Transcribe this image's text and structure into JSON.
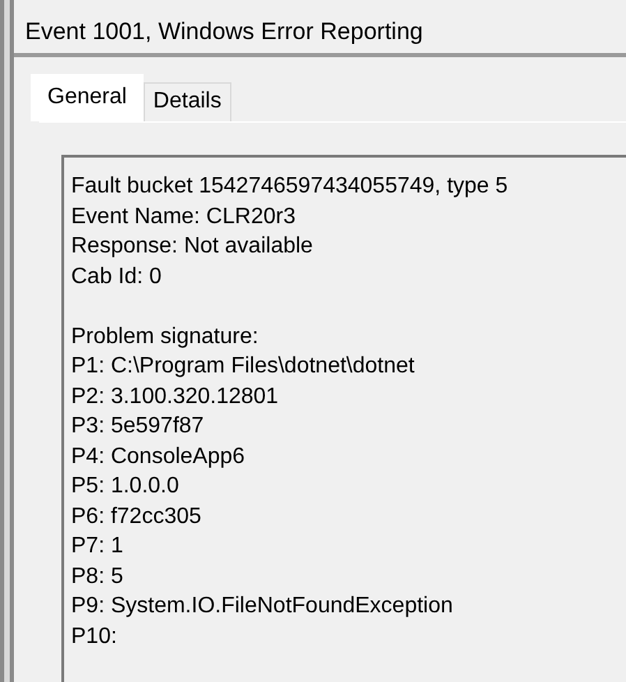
{
  "window": {
    "title": "Event 1001, Windows Error Reporting"
  },
  "tabs": [
    {
      "label": "General",
      "selected": true
    },
    {
      "label": "Details",
      "selected": false
    }
  ],
  "description": {
    "paragraphs": [
      [
        "Fault bucket 1542746597434055749, type 5",
        "Event Name: CLR20r3",
        "Response: Not available",
        "Cab Id: 0"
      ],
      [
        "Problem signature:",
        "P1: C:\\Program Files\\dotnet\\dotnet",
        "P2: 3.100.320.12801",
        "P3: 5e597f87",
        "P4: ConsoleApp6",
        "P5: 1.0.0.0",
        "P6: f72cc305",
        "P7: 1",
        "P8: 5",
        "P9: System.IO.FileNotFoundException",
        "P10:"
      ]
    ]
  }
}
